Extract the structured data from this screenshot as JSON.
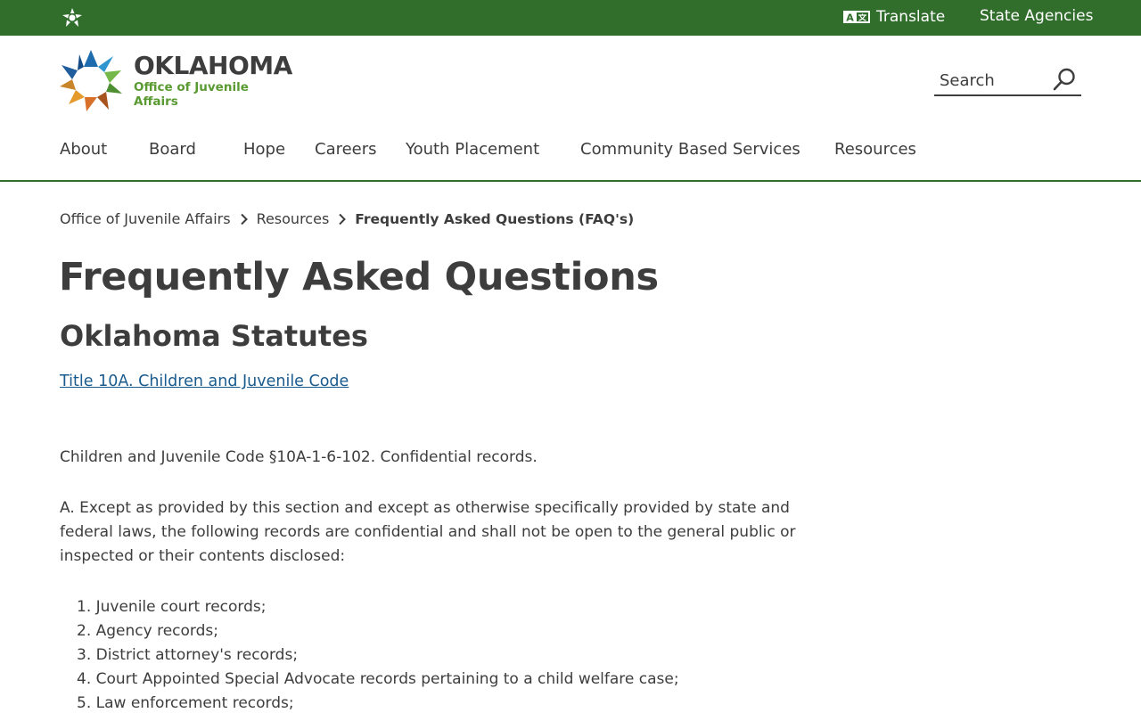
{
  "topbar": {
    "translate_label": "Translate",
    "agencies_label": "State Agencies",
    "icons": {
      "star": "oklahoma-star-icon",
      "translate": "translate-icon"
    }
  },
  "logo": {
    "line1": "OKLAHOMA",
    "line2": "Office of Juvenile Affairs"
  },
  "search": {
    "placeholder": "Search",
    "icon": "search-icon"
  },
  "nav": {
    "items": [
      {
        "label": "About"
      },
      {
        "label": "Board"
      },
      {
        "label": "Hope"
      },
      {
        "label": "Careers"
      },
      {
        "label": "Youth Placement"
      },
      {
        "label": "Community Based Services"
      },
      {
        "label": "Resources"
      }
    ]
  },
  "breadcrumb": {
    "items": [
      "Office of Juvenile Affairs",
      "Resources"
    ],
    "current": "Frequently Asked Questions (FAQ's)"
  },
  "main": {
    "title": "Frequently Asked Questions",
    "section_title": "Oklahoma Statutes",
    "link_text": "Title 10A. Children and Juvenile Code",
    "paragraph1": "Children and Juvenile Code §10A-1-6-102. Confidential records.",
    "paragraph2": "A. Except as provided by this section and except as otherwise specifically provided by state and federal laws, the following records are confidential and shall not be open to the general public or inspected or their contents disclosed:",
    "list": [
      "1.  Juvenile court records;",
      "2. Agency records;",
      "3. District attorney's records;",
      "4. Court Appointed Special Advocate records pertaining to a child welfare case;",
      "5. Law enforcement records;"
    ]
  },
  "colors": {
    "topbar": "#316e2c",
    "text": "#3d3d3d",
    "link": "#1a5b8e",
    "logo_green": "#5a9a32"
  }
}
